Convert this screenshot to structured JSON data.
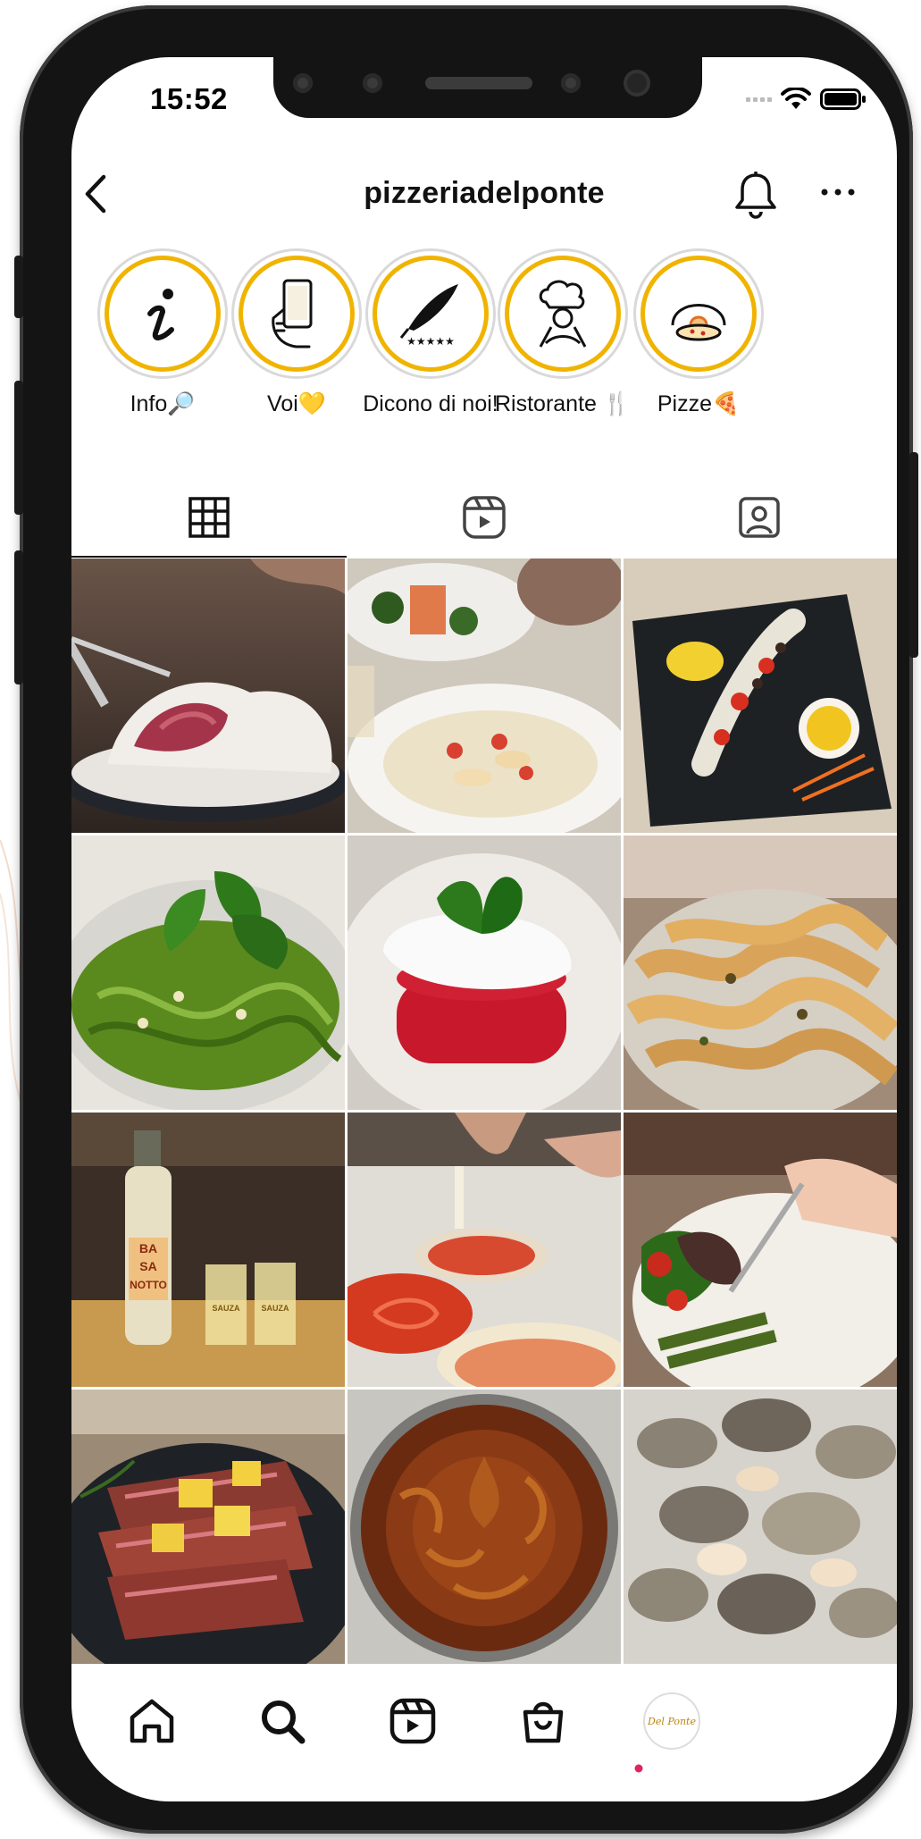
{
  "status": {
    "time": "15:52"
  },
  "profile": {
    "username": "pizzeriadelponte"
  },
  "highlights": [
    {
      "label": "Info🔎",
      "icon": "info-icon"
    },
    {
      "label": "Voi💛",
      "icon": "phone-hand-icon"
    },
    {
      "label": "Dicono di noi!",
      "icon": "quill-stars-icon"
    },
    {
      "label": "Ristorante 🍴",
      "icon": "chef-icon"
    },
    {
      "label": "Pizze🍕",
      "icon": "pizza-oven-icon"
    }
  ],
  "tabs": [
    {
      "name": "posts-grid",
      "icon": "grid-icon",
      "active": true
    },
    {
      "name": "reels",
      "icon": "reels-icon",
      "active": false
    },
    {
      "name": "tagged",
      "icon": "tagged-person-icon",
      "active": false
    }
  ],
  "posts": [
    {
      "subject": "seared tuna with sesame crust"
    },
    {
      "subject": "salmon starter and shellfish pasta"
    },
    {
      "subject": "octopus salad with tomatoes"
    },
    {
      "subject": "pasta with pesto and pine nuts"
    },
    {
      "subject": "burrata on beet tartare"
    },
    {
      "subject": "pappardelle with mushrooms"
    },
    {
      "subject": "bottle and shot glasses"
    },
    {
      "subject": "pizza preparation"
    },
    {
      "subject": "grilled tuna with vegetables"
    },
    {
      "subject": "sliced steak with potatoes"
    },
    {
      "subject": "tarte tatin"
    },
    {
      "subject": "clams"
    }
  ],
  "post_text": {
    "bottle_label": [
      "BA",
      "SA",
      "NOTTO"
    ],
    "glass_label": "SAUZA",
    "avatar_text": "Del Ponte"
  },
  "nav": [
    {
      "name": "home",
      "icon": "home-icon"
    },
    {
      "name": "search",
      "icon": "search-icon"
    },
    {
      "name": "reels",
      "icon": "reels-icon"
    },
    {
      "name": "shop",
      "icon": "shop-bag-icon"
    },
    {
      "name": "profile",
      "icon": "avatar"
    }
  ],
  "colors": {
    "highlight_ring": "#f0b400",
    "notification_dot": "#e0245e",
    "text": "#111111"
  }
}
